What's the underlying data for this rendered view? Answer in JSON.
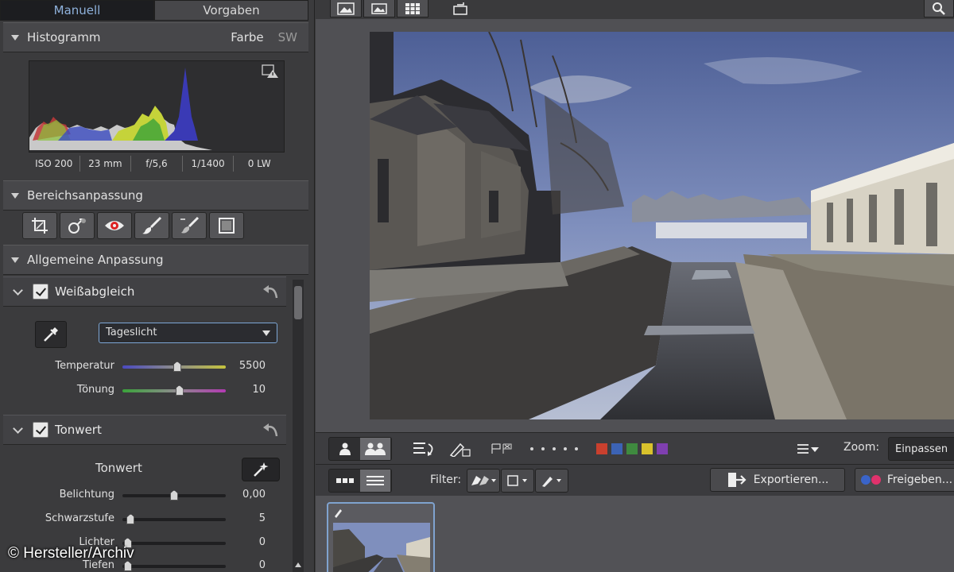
{
  "tabs": {
    "manual": "Manuell",
    "presets": "Vorgaben"
  },
  "histogram": {
    "title": "Histogramm",
    "mode_color": "Farbe",
    "mode_bw": "SW",
    "exif": {
      "iso": "ISO 200",
      "focal": "23 mm",
      "aperture": "f/5,6",
      "shutter": "1/1400",
      "ev": "0 LW"
    }
  },
  "area_adjust": {
    "title": "Bereichsanpassung"
  },
  "general_adjust": {
    "title": "Allgemeine Anpassung"
  },
  "white_balance": {
    "title": "Weißabgleich",
    "preset": "Tageslicht",
    "temperature": {
      "label": "Temperatur",
      "value": "5500",
      "fraction": 0.53
    },
    "tint": {
      "label": "Tönung",
      "value": "10",
      "fraction": 0.55
    }
  },
  "tone": {
    "title": "Tonwert",
    "subtitle": "Tonwert",
    "exposure": {
      "label": "Belichtung",
      "value": "0,00",
      "fraction": 0.5
    },
    "blacks": {
      "label": "Schwarzstufe",
      "value": "5",
      "fraction": 0.08
    },
    "highlights": {
      "label": "Lichter",
      "value": "0",
      "fraction": 0.05
    },
    "shadows": {
      "label": "Tiefen",
      "value": "0",
      "fraction": 0.05
    }
  },
  "toolbar2": {
    "zoom_label": "Zoom:",
    "zoom_value": "Einpassen",
    "filter_label": "Filter:",
    "export_label": "Exportieren...",
    "share_label": "Freigeben..."
  },
  "color_labels": [
    "#c9402e",
    "#3c63b5",
    "#3f8a3f",
    "#d9c22c",
    "#7f3fb0"
  ],
  "copyright": "© Hersteller/Archiv"
}
